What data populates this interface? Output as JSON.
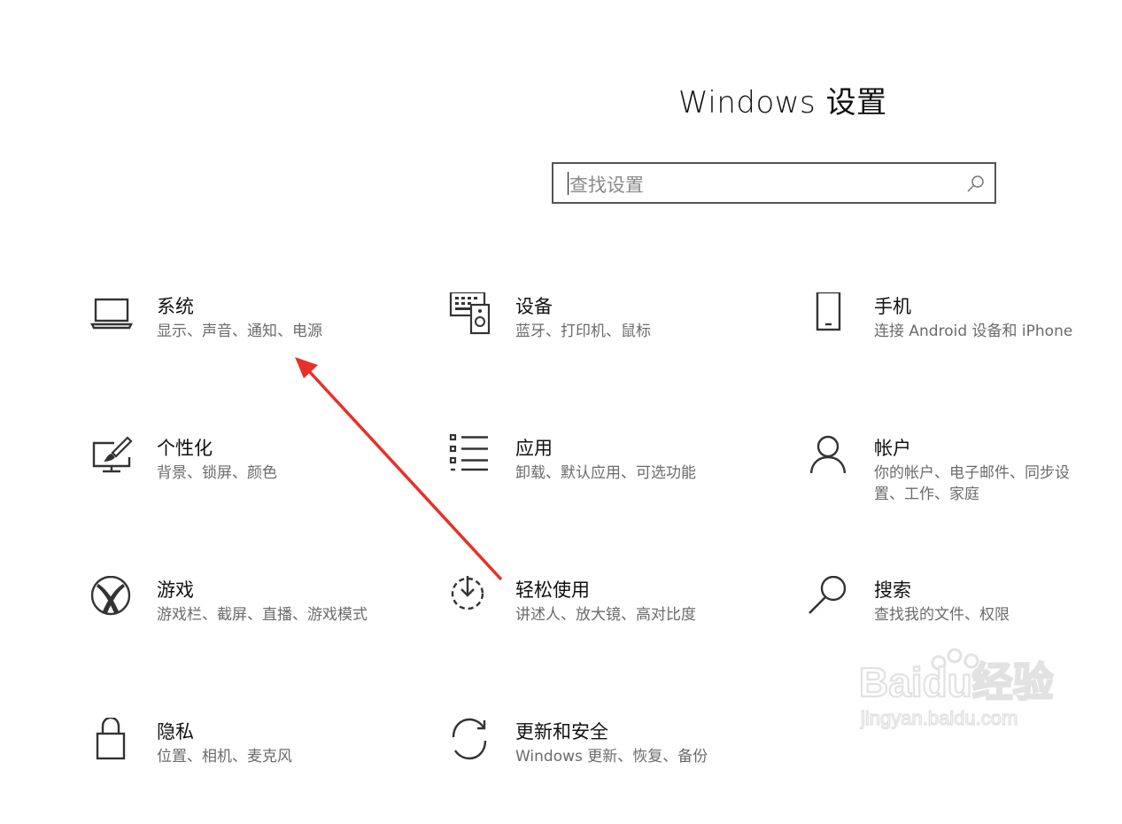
{
  "page": {
    "title": "Windows 设置"
  },
  "search": {
    "placeholder": "查找设置",
    "icon": "search-icon"
  },
  "tiles": [
    {
      "name": "系统",
      "desc": "显示、声音、通知、电源",
      "icon": "laptop-icon"
    },
    {
      "name": "设备",
      "desc": "蓝牙、打印机、鼠标",
      "icon": "devices-icon"
    },
    {
      "name": "手机",
      "desc": "连接 Android 设备和 iPhone",
      "icon": "phone-icon"
    },
    {
      "name": "个性化",
      "desc": "背景、锁屏、颜色",
      "icon": "personalization-icon"
    },
    {
      "name": "应用",
      "desc": "卸载、默认应用、可选功能",
      "icon": "apps-list-icon"
    },
    {
      "name": "帐户",
      "desc": "你的帐户、电子邮件、同步设置、工作、家庭",
      "icon": "person-icon"
    },
    {
      "name": "游戏",
      "desc": "游戏栏、截屏、直播、游戏模式",
      "icon": "xbox-icon"
    },
    {
      "name": "轻松使用",
      "desc": "讲述人、放大镜、高对比度",
      "icon": "ease-of-access-icon"
    },
    {
      "name": "搜索",
      "desc": "查找我的文件、权限",
      "icon": "search-icon"
    },
    {
      "name": "隐私",
      "desc": "位置、相机、麦克风",
      "icon": "lock-icon"
    },
    {
      "name": "更新和安全",
      "desc": "Windows 更新、恢复、备份",
      "icon": "update-sync-icon"
    }
  ],
  "watermark": {
    "brand": "Baidu经验",
    "url": "jingyan.baidu.com"
  },
  "annotation": {
    "arrow_color": "#e8302a"
  }
}
